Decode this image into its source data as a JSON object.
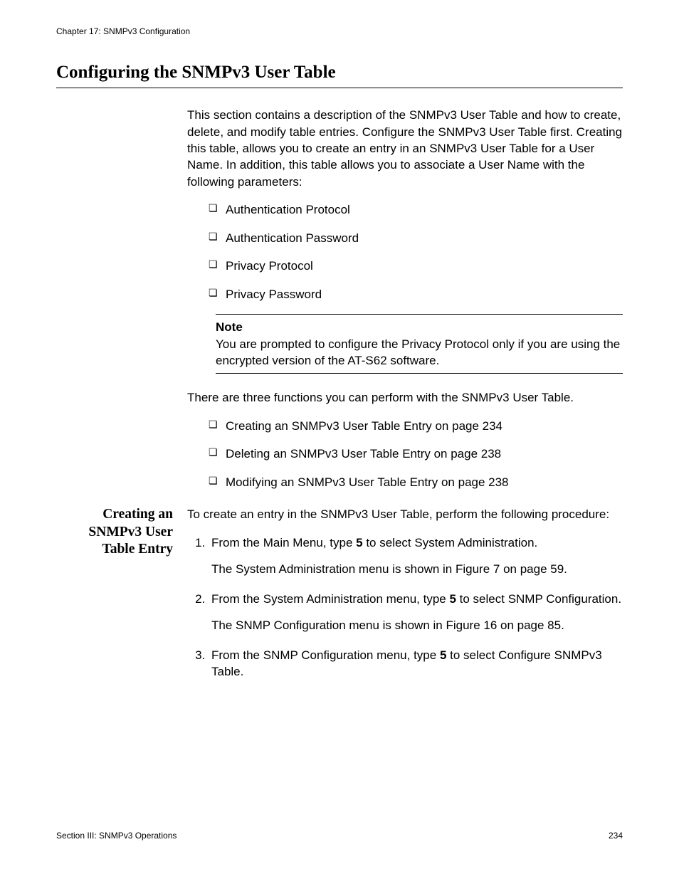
{
  "header": {
    "chapter": "Chapter 17: SNMPv3 Configuration"
  },
  "title": "Configuring the SNMPv3 User Table",
  "intro": "This section contains a description of the SNMPv3 User Table and how to create, delete, and modify table entries. Configure the SNMPv3 User Table first. Creating this table, allows you to create an entry in an SNMPv3 User Table for a User Name. In addition, this table allows you to associate a User Name with the following parameters:",
  "param_list": [
    "Authentication Protocol",
    "Authentication Password",
    "Privacy Protocol",
    "Privacy Password"
  ],
  "note": {
    "label": "Note",
    "text": "You are prompted to configure the Privacy Protocol only if you are using the encrypted version of the AT-S62 software."
  },
  "functions_intro": "There are three functions you can perform with the SNMPv3 User Table.",
  "functions_list": [
    "Creating an SNMPv3 User Table Entry on page 234",
    "Deleting an SNMPv3 User Table Entry on page 238",
    "Modifying an SNMPv3 User Table Entry on page 238"
  ],
  "subhead": "Creating an SNMPv3 User Table Entry",
  "proc_intro": "To create an entry in the SNMPv3 User Table, perform the following procedure:",
  "steps": [
    {
      "pre": "From the Main Menu, type ",
      "bold": "5",
      "post": " to select System Administration.",
      "after": "The System Administration menu is shown in Figure 7  on page 59."
    },
    {
      "pre": "From the System Administration menu, type ",
      "bold": "5",
      "post": " to select SNMP Configuration.",
      "after": "The SNMP Configuration menu is shown in Figure 16  on page 85."
    },
    {
      "pre": "From the SNMP Configuration menu, type ",
      "bold": "5",
      "post": " to select Configure SNMPv3 Table.",
      "after": ""
    }
  ],
  "footer": {
    "section": "Section III: SNMPv3 Operations",
    "page": "234"
  }
}
